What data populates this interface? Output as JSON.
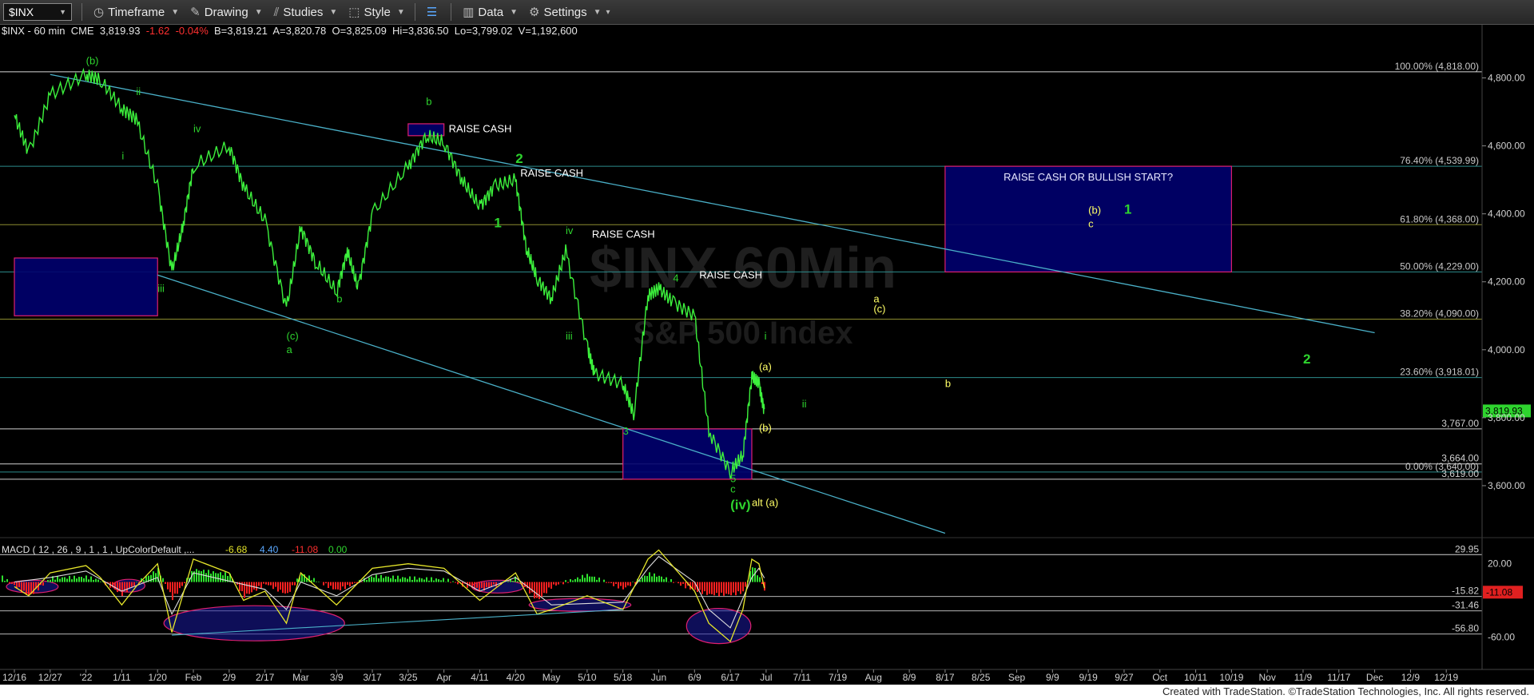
{
  "toolbar": {
    "symbol": "$INX",
    "items": [
      {
        "label": "Timeframe",
        "icon": "clock-icon"
      },
      {
        "label": "Drawing",
        "icon": "pencil-icon"
      },
      {
        "label": "Studies",
        "icon": "studies-icon"
      },
      {
        "label": "Style",
        "icon": "style-icon"
      },
      {
        "label": "Data",
        "icon": "data-icon"
      },
      {
        "label": "Settings",
        "icon": "gear-icon"
      }
    ]
  },
  "info": {
    "symbol": "$INX - 60 min",
    "exchange": "CME",
    "last": "3,819.93",
    "change": "-1.62",
    "pct": "-0.04%",
    "bid": "B=3,819.21",
    "ask": "A=3,820.78",
    "open": "O=3,825.09",
    "high": "Hi=3,836.50",
    "low": "Lo=3,799.02",
    "volume": "V=1,192,600"
  },
  "watermark": {
    "line1": "$INX 60Min",
    "line2": "S&P 500 Index"
  },
  "footer": "Created with TradeStation. ©TradeStation Technologies, Inc. All rights reserved.",
  "colors": {
    "price": "#3cf03c",
    "bull": "#2ed42e",
    "yellow": "#ffff66",
    "box": "#00006e",
    "boxBorder": "#e0206e",
    "trend": "#4ab0c8",
    "fib": "#2c8c8c",
    "macdLine": "#e6e62a",
    "signal": "#dddddd",
    "histUp": "#2ee02e",
    "histDown": "#ff2020"
  },
  "chart_data": [
    {
      "type": "line",
      "title": "$INX - 60 min",
      "x_dates": [
        "12/16",
        "12/27",
        "'22",
        "1/11",
        "1/20",
        "Feb",
        "2/9",
        "2/17",
        "Mar",
        "3/9",
        "3/17",
        "3/25",
        "Apr",
        "4/11",
        "4/20",
        "May",
        "5/10",
        "5/18",
        "Jun",
        "6/9",
        "6/17",
        "Jul",
        "7/11",
        "7/19",
        "Aug",
        "8/9",
        "8/17",
        "8/25",
        "Sep",
        "9/9",
        "9/19",
        "9/27",
        "Oct",
        "10/11",
        "10/19",
        "Nov",
        "11/9",
        "11/17",
        "Dec",
        "12/9",
        "12/19"
      ],
      "ylim": [
        3440,
        4900
      ],
      "y_ticks": [
        "3,600.00",
        "3,800.00",
        "4,000.00",
        "4,200.00",
        "4,400.00",
        "4,600.00",
        "4,800.00"
      ],
      "y_tick_values": [
        3600,
        3800,
        4000,
        4200,
        4400,
        4600,
        4800
      ],
      "last_price": "3,819.93",
      "last_price_value": 3819.93,
      "series": [
        {
          "points": [
            [
              "12/16",
              4690
            ],
            [
              "12/20",
              4580
            ],
            [
              "12/27",
              4750
            ],
            [
              "'22",
              4810
            ],
            [
              "1/4",
              4795
            ],
            [
              "1/11",
              4710
            ],
            [
              "1/14",
              4680
            ],
            [
              "1/20",
              4480
            ],
            [
              "1/24",
              4230
            ],
            [
              "1/27",
              4360
            ],
            [
              "Feb",
              4540
            ],
            [
              "2/9",
              4600
            ],
            [
              "2/12",
              4480
            ],
            [
              "2/17",
              4380
            ],
            [
              "2/24",
              4120
            ],
            [
              "Mar",
              4360
            ],
            [
              "3/4",
              4260
            ],
            [
              "3/9",
              4170
            ],
            [
              "3/11",
              4290
            ],
            [
              "3/14",
              4180
            ],
            [
              "3/17",
              4400
            ],
            [
              "3/25",
              4540
            ],
            [
              "3/29",
              4630
            ],
            [
              "Apr",
              4610
            ],
            [
              "4/6",
              4500
            ],
            [
              "4/11",
              4420
            ],
            [
              "4/14",
              4480
            ],
            [
              "4/20",
              4500
            ],
            [
              "4/22",
              4300
            ],
            [
              "4/26",
              4210
            ],
            [
              "May",
              4150
            ],
            [
              "5/4",
              4290
            ],
            [
              "5/10",
              4010
            ],
            [
              "5/12",
              3930
            ],
            [
              "5/18",
              3900
            ],
            [
              "5/20",
              3810
            ],
            [
              "5/27",
              4160
            ],
            [
              "Jun",
              4180
            ],
            [
              "6/3",
              4140
            ],
            [
              "6/9",
              4100
            ],
            [
              "6/13",
              3760
            ],
            [
              "6/17",
              3640
            ],
            [
              "6/20",
              3690
            ],
            [
              "6/24",
              3920
            ],
            [
              "6/28",
              3900
            ],
            [
              "7/1",
              3819.93
            ]
          ]
        }
      ],
      "fib_levels": [
        {
          "label": "100.00% (4,818.00)",
          "value": 4818
        },
        {
          "label": "76.40% (4,539.99)",
          "value": 4539.99
        },
        {
          "label": "61.80% (4,368.00)",
          "value": 4368
        },
        {
          "label": "50.00% (4,229.00)",
          "value": 4229
        },
        {
          "label": "38.20% (4,090.00)",
          "value": 4090
        },
        {
          "label": "23.60% (3,918.01)",
          "value": 3918.01
        },
        {
          "label": "0.00% (3,640.00)",
          "value": 3640
        }
      ],
      "horizontal_levels": [
        {
          "label": "3,767.00",
          "value": 3767
        },
        {
          "label": "3,664.00",
          "value": 3664
        },
        {
          "label": "3,619.00",
          "value": 3619
        }
      ],
      "trendlines": [
        {
          "from": [
            "12/27",
            4810
          ],
          "to": [
            "Dec",
            4050
          ]
        },
        {
          "from": [
            "1/20",
            4220
          ],
          "to": [
            "8/17",
            3460
          ]
        }
      ],
      "boxes": [
        {
          "from": [
            "12/16",
            4270
          ],
          "to": [
            "1/20",
            4100
          ],
          "label": ""
        },
        {
          "from": [
            "3/25",
            4665
          ],
          "to": [
            "Apr",
            4630
          ],
          "label": ""
        },
        {
          "from": [
            "5/18",
            3767
          ],
          "to": [
            "6/24",
            3619
          ],
          "label": ""
        },
        {
          "from": [
            "8/17",
            4540
          ],
          "to": [
            "10/19",
            4229
          ],
          "label": "RAISE CASH OR BULLISH START?"
        }
      ],
      "annotations": [
        {
          "text": "RAISE CASH",
          "at": [
            "Apr",
            4640
          ],
          "color": "white"
        },
        {
          "text": "RAISE CASH",
          "at": [
            "4/20",
            4510
          ],
          "color": "white"
        },
        {
          "text": "RAISE CASH",
          "at": [
            "5/10",
            4330
          ],
          "color": "white"
        },
        {
          "text": "RAISE CASH",
          "at": [
            "6/9",
            4210
          ],
          "color": "white"
        },
        {
          "text": "(b)",
          "at": [
            "'22",
            4840
          ],
          "color": "green"
        },
        {
          "text": "b",
          "at": [
            "3/29",
            4720
          ],
          "color": "green"
        },
        {
          "text": "ii",
          "at": [
            "1/14",
            4750
          ],
          "color": "green"
        },
        {
          "text": "iv",
          "at": [
            "Feb",
            4640
          ],
          "color": "green"
        },
        {
          "text": "i",
          "at": [
            "1/11",
            4560
          ],
          "color": "green"
        },
        {
          "text": "iii",
          "at": [
            "1/20",
            4170
          ],
          "color": "green"
        },
        {
          "text": "(c)",
          "at": [
            "2/24",
            4030
          ],
          "color": "green"
        },
        {
          "text": "a",
          "at": [
            "2/24",
            3990
          ],
          "color": "green"
        },
        {
          "text": "b",
          "at": [
            "3/9",
            4140
          ],
          "color": "green"
        },
        {
          "text": "2",
          "at": [
            "4/20",
            4550
          ],
          "color": "green"
        },
        {
          "text": "1",
          "at": [
            "4/14",
            4360
          ],
          "color": "green"
        },
        {
          "text": "iv",
          "at": [
            "5/4",
            4340
          ],
          "color": "green"
        },
        {
          "text": "iii",
          "at": [
            "5/4",
            4030
          ],
          "color": "green"
        },
        {
          "text": "3",
          "at": [
            "5/18",
            3750
          ],
          "color": "green"
        },
        {
          "text": "4",
          "at": [
            "6/3",
            4200
          ],
          "color": "green"
        },
        {
          "text": "5",
          "at": [
            "6/17",
            3610
          ],
          "color": "green"
        },
        {
          "text": "c",
          "at": [
            "6/17",
            3580
          ],
          "color": "green"
        },
        {
          "text": "(iv)",
          "at": [
            "6/17",
            3530
          ],
          "color": "green"
        },
        {
          "text": "alt (a)",
          "at": [
            "6/24",
            3540
          ],
          "color": "yellow"
        },
        {
          "text": "i",
          "at": [
            "7/1",
            4030
          ],
          "color": "green"
        },
        {
          "text": "ii",
          "at": [
            "7/11",
            3830
          ],
          "color": "green"
        },
        {
          "text": "(a)",
          "at": [
            "6/28",
            3940
          ],
          "color": "yellow"
        },
        {
          "text": "(b)",
          "at": [
            "6/28",
            3760
          ],
          "color": "yellow"
        },
        {
          "text": "a",
          "at": [
            "Aug",
            4140
          ],
          "color": "yellow"
        },
        {
          "text": "(c)",
          "at": [
            "Aug",
            4110
          ],
          "color": "yellow"
        },
        {
          "text": "b",
          "at": [
            "8/17",
            3890
          ],
          "color": "yellow"
        },
        {
          "text": "(b)",
          "at": [
            "9/19",
            4400
          ],
          "color": "yellow"
        },
        {
          "text": "1",
          "at": [
            "9/27",
            4400
          ],
          "color": "green"
        },
        {
          "text": "c",
          "at": [
            "9/19",
            4360
          ],
          "color": "yellow"
        },
        {
          "text": "2",
          "at": [
            "11/9",
            3960
          ],
          "color": "green"
        }
      ]
    },
    {
      "type": "line",
      "title": "MACD ( 12 , 26 , 9 , 1 , 1 , UpColorDefault ,...",
      "legend_values": [
        "-6.68",
        "4.40",
        "-11.08",
        "0.00"
      ],
      "ylim": [
        -78,
        45
      ],
      "y_ticks": [
        "20.00",
        "-60.00"
      ],
      "y_tick_values": [
        20,
        -60
      ],
      "levels": [
        {
          "label": "29.95",
          "value": 29.95
        },
        {
          "label": "-15.82",
          "value": -15.82
        },
        {
          "label": "-31.46",
          "value": -31.46
        },
        {
          "label": "-56.80",
          "value": -56.8
        }
      ],
      "last_value": "-11.08",
      "series": [
        {
          "points": [
            [
              "12/16",
              -5
            ],
            [
              "12/20",
              -15
            ],
            [
              "12/27",
              10
            ],
            [
              "'22",
              18
            ],
            [
              "1/4",
              5
            ],
            [
              "1/11",
              -25
            ],
            [
              "1/14",
              -5
            ],
            [
              "1/20",
              20
            ],
            [
              "1/24",
              -55
            ],
            [
              "Feb",
              25
            ],
            [
              "2/9",
              10
            ],
            [
              "2/12",
              -20
            ],
            [
              "2/17",
              -10
            ],
            [
              "2/24",
              -45
            ],
            [
              "Mar",
              10
            ],
            [
              "3/9",
              -25
            ],
            [
              "3/17",
              15
            ],
            [
              "3/25",
              20
            ],
            [
              "Apr",
              15
            ],
            [
              "4/11",
              -20
            ],
            [
              "4/20",
              10
            ],
            [
              "4/26",
              -35
            ],
            [
              "May",
              -30
            ],
            [
              "5/10",
              -15
            ],
            [
              "5/18",
              -30
            ],
            [
              "5/27",
              25
            ],
            [
              "Jun",
              35
            ],
            [
              "6/9",
              -10
            ],
            [
              "6/13",
              -45
            ],
            [
              "6/17",
              -65
            ],
            [
              "6/20",
              -30
            ],
            [
              "6/24",
              25
            ],
            [
              "6/28",
              20
            ],
            [
              "7/1",
              -6.68
            ]
          ]
        },
        {
          "points": [
            [
              "12/16",
              0
            ],
            [
              "12/27",
              5
            ],
            [
              "'22",
              12
            ],
            [
              "1/11",
              -10
            ],
            [
              "1/20",
              5
            ],
            [
              "1/24",
              -35
            ],
            [
              "Feb",
              10
            ],
            [
              "2/17",
              -8
            ],
            [
              "2/24",
              -30
            ],
            [
              "Mar",
              0
            ],
            [
              "3/9",
              -15
            ],
            [
              "3/17",
              8
            ],
            [
              "3/25",
              15
            ],
            [
              "Apr",
              12
            ],
            [
              "4/11",
              -10
            ],
            [
              "4/20",
              5
            ],
            [
              "May",
              -25
            ],
            [
              "5/18",
              -22
            ],
            [
              "5/27",
              15
            ],
            [
              "Jun",
              28
            ],
            [
              "6/9",
              0
            ],
            [
              "6/13",
              -30
            ],
            [
              "6/17",
              -50
            ],
            [
              "6/24",
              5
            ],
            [
              "6/28",
              15
            ],
            [
              "7/1",
              4.4
            ]
          ]
        }
      ],
      "ellipses": [
        {
          "from": [
            "12/16",
            -5
          ],
          "to": [
            "12/27",
            -5
          ]
        },
        {
          "from": [
            "1/11",
            -4
          ],
          "to": [
            "1/14",
            -4
          ]
        },
        {
          "from": [
            "1/24",
            -45
          ],
          "to": [
            "3/9",
            -45
          ]
        },
        {
          "from": [
            "4/11",
            -5
          ],
          "to": [
            "4/20",
            -5
          ]
        },
        {
          "from": [
            "4/26",
            -25
          ],
          "to": [
            "5/18",
            -25
          ]
        },
        {
          "from": [
            "6/9",
            -48
          ],
          "to": [
            "6/20",
            -48
          ]
        }
      ]
    }
  ]
}
